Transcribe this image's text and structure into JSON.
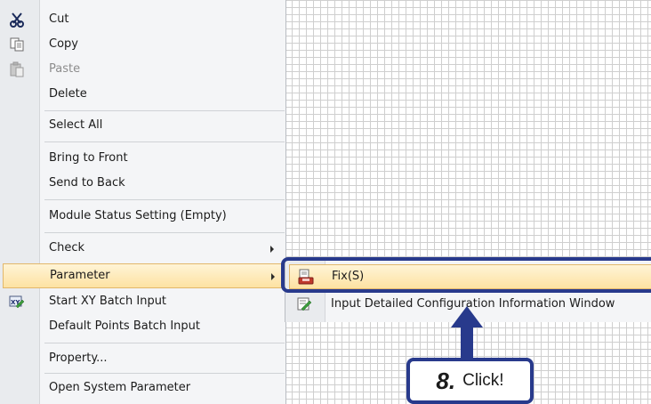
{
  "context_menu": {
    "items": [
      {
        "label": "Cut",
        "icon": "scissors-icon",
        "enabled": true
      },
      {
        "label": "Copy",
        "icon": "copy-icon",
        "enabled": true
      },
      {
        "label": "Paste",
        "icon": "paste-icon",
        "enabled": false
      },
      {
        "label": "Delete",
        "icon": "",
        "enabled": true
      },
      {
        "label": "Select All",
        "icon": "",
        "enabled": true
      },
      {
        "label": "Bring to Front",
        "icon": "",
        "enabled": true
      },
      {
        "label": "Send to Back",
        "icon": "",
        "enabled": true
      },
      {
        "label": "Module Status Setting (Empty)",
        "icon": "",
        "enabled": true
      },
      {
        "label": "Check",
        "icon": "",
        "enabled": true,
        "has_submenu": true
      },
      {
        "label": "Parameter",
        "icon": "",
        "enabled": true,
        "has_submenu": true,
        "highlighted": true
      },
      {
        "label": "Start XY Batch Input",
        "icon": "xy-batch-icon",
        "enabled": true
      },
      {
        "label": "Default Points Batch Input",
        "icon": "",
        "enabled": true
      },
      {
        "label": "Property...",
        "icon": "",
        "enabled": true
      },
      {
        "label": "Open System Parameter",
        "icon": "",
        "enabled": true
      }
    ]
  },
  "submenu": {
    "items": [
      {
        "label": "Fix(S)",
        "icon": "fix-parameter-icon",
        "highlighted": true
      },
      {
        "label": "Input Detailed Configuration Information Window",
        "icon": "edit-window-icon"
      }
    ]
  },
  "callout": {
    "step": "8.",
    "text": "Click!"
  },
  "colors": {
    "callout": "#283a8c",
    "highlight": "#fde2a2",
    "highlight_border": "#e2b76a",
    "grid": "#cfcfcf"
  }
}
